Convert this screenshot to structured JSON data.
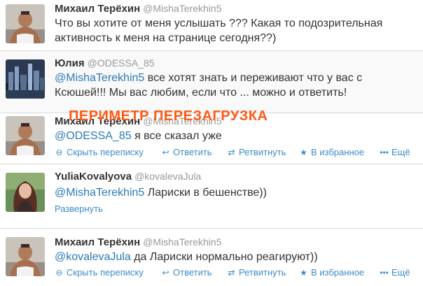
{
  "overlay_text": "ПЕРИМЕТР ПЕРЕЗАГРУЗКА",
  "colors": {
    "link": "#3b8ccb",
    "mention": "#2a7ab6",
    "overlay": "#ff5a14",
    "handle": "#999999"
  },
  "tweets": [
    {
      "name": "Михаил Терёхин",
      "handle": "@MishaTerekhin5",
      "text_line1": "Что вы хотите от меня услышать ??? Какая то подозрительная",
      "text_line2": "активность к меня на странице сегодня??)"
    },
    {
      "name": "Юлия",
      "handle": "@ODESSA_85",
      "mention": "@MishaTerekhin5",
      "text_line1_rest": " все хотят знать и переживают что у вас с",
      "text_line2": "Ксюшей!!! Мы вас любим, если что ... можно и ответить!"
    },
    {
      "name": "Михаил Терёхин",
      "handle": "@MishaTerekhin5",
      "mention": "@ODESSA_85",
      "text_rest": " я все сказал уже",
      "actions": {
        "hide": "Скрыть переписку",
        "reply": "Ответить",
        "retweet": "Ретвитнуть",
        "favorite": "В избранное",
        "more": "Ещё"
      }
    },
    {
      "name": "YuliaKovalyova",
      "handle": "@kovalevaJula",
      "mention": "@MishaTerekhin5",
      "text_rest": " Лариски в бешенстве))",
      "expand": "Развернуть"
    },
    {
      "name": "Михаил Терёхин",
      "handle": "@MishaTerekhin5",
      "mention": "@kovalevaJula",
      "text_rest": " да Лариски нормально реагируют))",
      "actions": {
        "hide": "Скрыть переписку",
        "reply": "Ответить",
        "retweet": "Ретвитнуть",
        "favorite": "В избранное",
        "more": "Ещё"
      }
    }
  ]
}
